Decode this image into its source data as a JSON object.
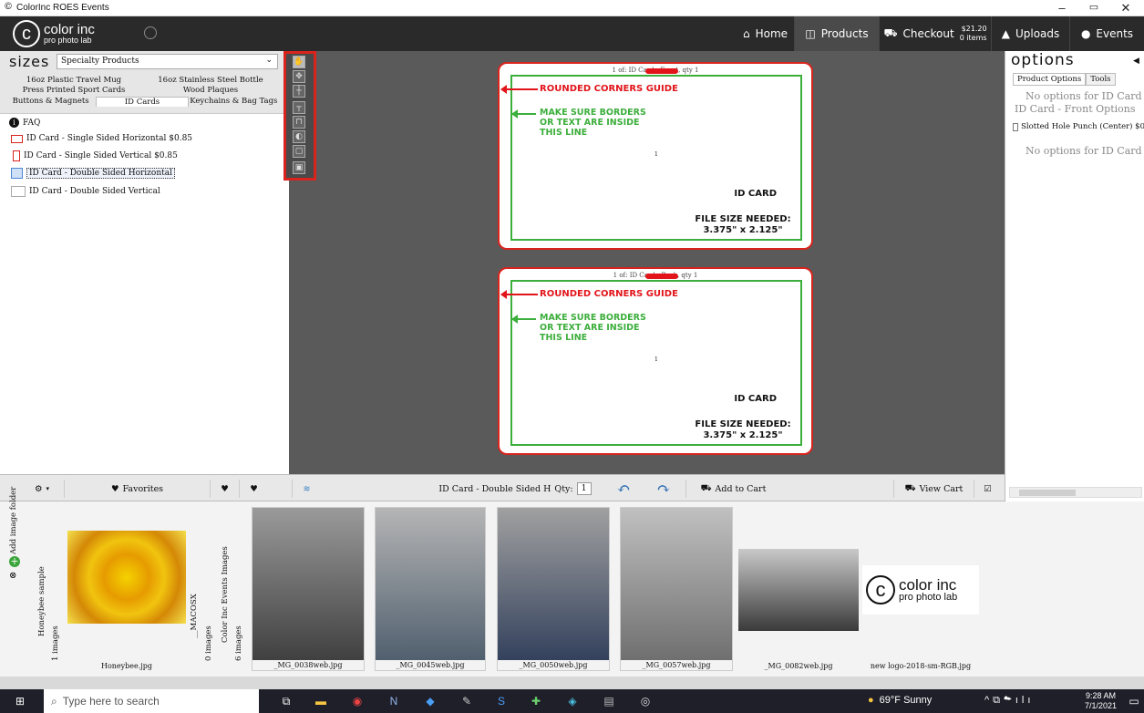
{
  "window": {
    "title": "ColorInc ROES Events",
    "minimize": "–",
    "maximize": "▭",
    "close": "✕"
  },
  "app": {
    "logo_mark": "c",
    "logo_line1": "color inc",
    "logo_line2": "pro photo lab",
    "nav": {
      "home": "Home",
      "products": "Products",
      "checkout": "Checkout",
      "checkout_total": "$21.20",
      "checkout_items": "0 items",
      "uploads": "Uploads",
      "events": "Events"
    }
  },
  "left": {
    "header": "sizes",
    "category": "Specialty Products",
    "tabs_row1": [
      "16oz Plastic Travel Mug",
      "16oz Stainless Steel Bottle"
    ],
    "tabs_row2": [
      "Press Printed Sport Cards",
      "Wood Plaques"
    ],
    "tabs_row3": [
      "Buttons & Magnets",
      "ID Cards",
      "Keychains & Bag Tags"
    ],
    "items": [
      "FAQ",
      "ID Card - Single Sided Horizontal $0.85",
      "ID Card - Single Sided Vertical $0.85",
      "ID Card - Double Sided Horizontal",
      "ID Card - Double Sided Vertical"
    ]
  },
  "cards": [
    {
      "caption": "1 of: ID Card - Front, qty 1",
      "guide": "ROUNDED CORNERS GUIDE",
      "make_sure": "MAKE SURE BORDERS OR TEXT ARE INSIDE THIS LINE",
      "num": "1",
      "id_card": "ID CARD",
      "file_size": "FILE SIZE NEEDED:",
      "dims": "3.375\" x 2.125\""
    },
    {
      "caption": "1 of: ID Card - Back, qty 1",
      "guide": "ROUNDED CORNERS GUIDE",
      "make_sure": "MAKE SURE BORDERS OR TEXT ARE INSIDE THIS LINE",
      "num": "1",
      "id_card": "ID CARD",
      "file_size": "FILE SIZE NEEDED:",
      "dims": "3.375\" x 2.125\""
    }
  ],
  "right": {
    "header": "options",
    "tab1": "Product Options",
    "tab2": "Tools",
    "no_opts1": "No options for ID Card -",
    "front_opts": "ID Card - Front Options",
    "punch": "Slotted Hole Punch (Center) $0",
    "no_opts2": "No options for ID Card -"
  },
  "toolbar": {
    "favorites": "Favorites",
    "product": "ID Card - Double Sided H",
    "qty_label": "Qty:",
    "qty": "1",
    "add_to_cart": "Add to Cart",
    "view_cart": "View Cart"
  },
  "filmstrip": {
    "add_folder": "Add image folder",
    "folder1_name": "Honeybee sample",
    "folder1_count": "1 images",
    "folder2_name": "__MACOSX",
    "folder2_count": "0 images",
    "folder3_name": "Color Inc Events Images",
    "folder3_count": "6 images",
    "images": [
      "Honeybee.jpg",
      "_MG_0038web.jpg",
      "_MG_0045web.jpg",
      "_MG_0050web.jpg",
      "_MG_0057web.jpg",
      "_MG_0082web.jpg",
      "new logo-2018-sm-RGB.jpg"
    ]
  },
  "taskbar": {
    "search": "Type here to search",
    "weather": "69°F  Sunny",
    "time": "9:28 AM",
    "date": "7/1/2021"
  }
}
